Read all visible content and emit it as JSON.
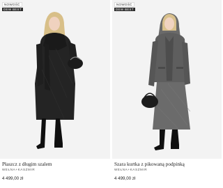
{
  "products": [
    {
      "badges": {
        "new": "NOWOŚĆ",
        "best": "DEW BEST"
      },
      "title": "Płaszcz z długim szalem",
      "material": "WEŁNA+KASZMIR",
      "price": "4 499,00 zł",
      "colors": {
        "coat": "#242424",
        "background": "#f3f3f3"
      }
    },
    {
      "badges": {
        "new": "NOWOŚĆ",
        "best": "DEW BEST"
      },
      "title": "Szara kurtka z pikowaną podpinką",
      "material": "WEŁNA+KASZMIR",
      "price": "4 499,00 zł",
      "colors": {
        "coat": "#5e5e5e",
        "background": "#f3f3f3"
      }
    }
  ]
}
